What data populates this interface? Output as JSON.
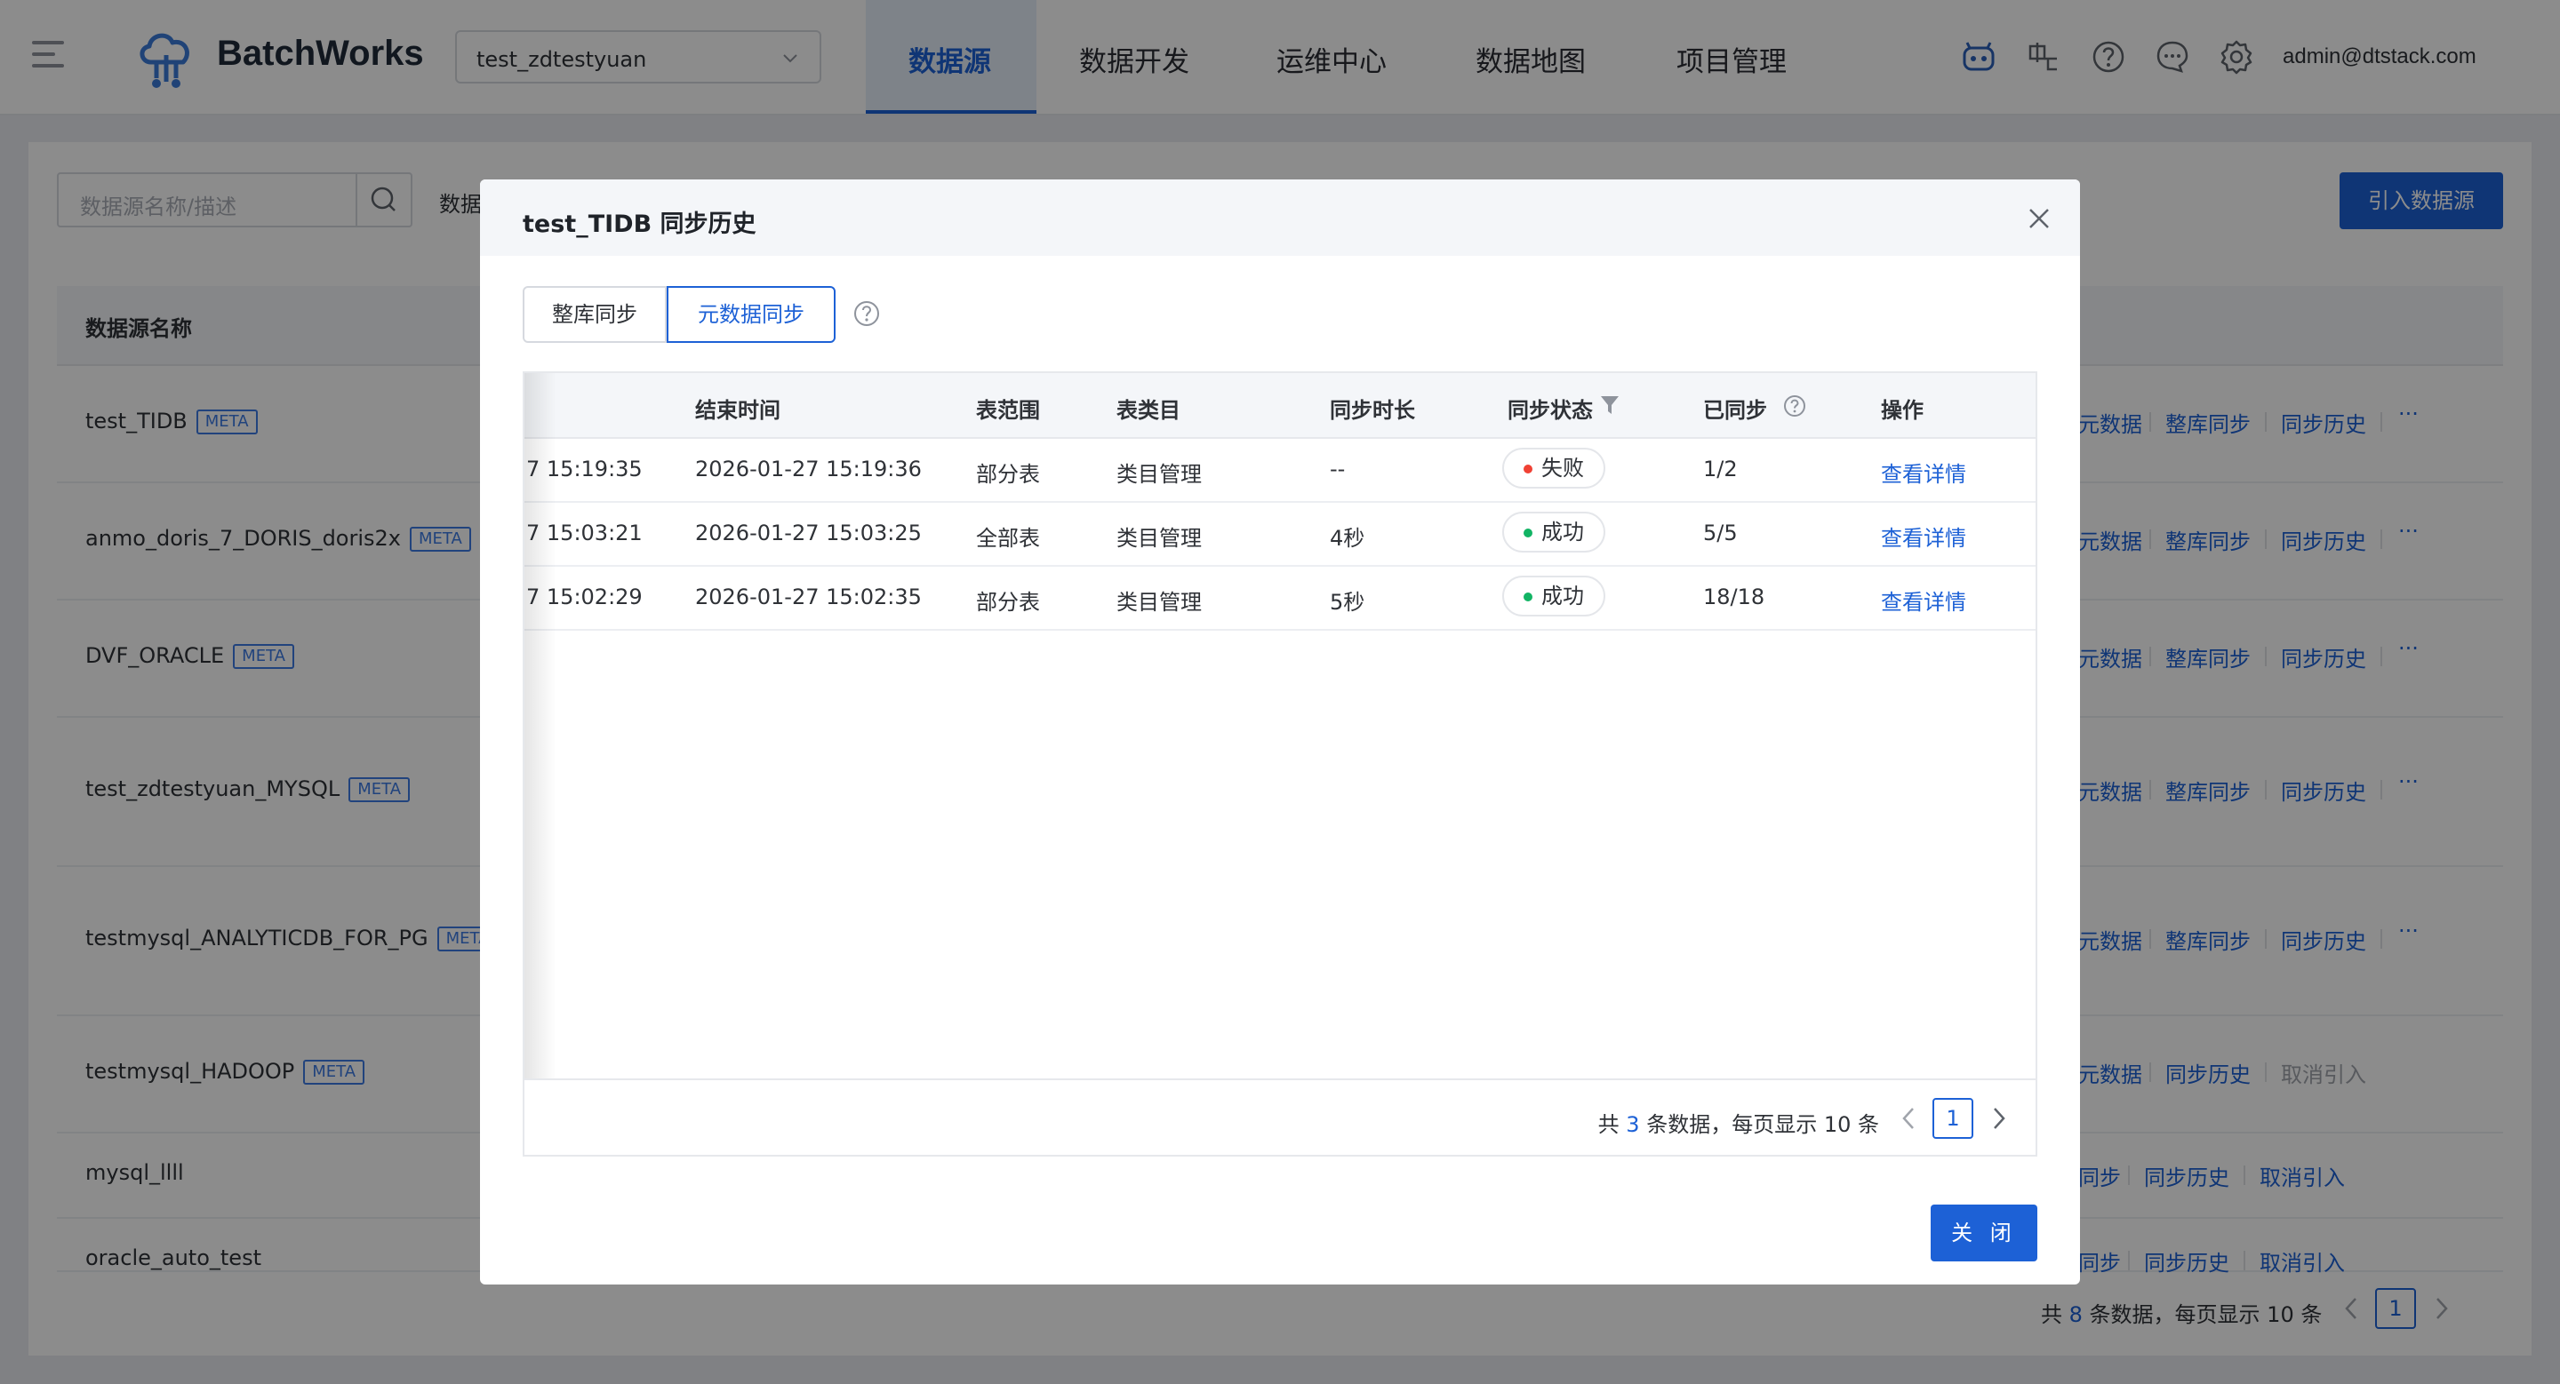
{
  "header": {
    "app_name": "BatchWorks",
    "project": "test_zdtestyuan",
    "nav": [
      "数据源",
      "数据开发",
      "运维中心",
      "数据地图",
      "项目管理"
    ],
    "active_nav": "数据源",
    "icons": [
      "robot-icon",
      "language-icon",
      "help-icon",
      "message-icon",
      "settings-icon"
    ],
    "user_email": "admin@dtstack.com"
  },
  "toolbar": {
    "search_placeholder": "数据源名称/描述",
    "filter_label": "数据",
    "import_label": "引入数据源"
  },
  "background_table": {
    "column_name": "数据源名称",
    "meta_tag": "META",
    "rows": [
      {
        "name": "test_TIDB",
        "ops": [
          "元数据",
          "整库同步",
          "同步历史",
          "···"
        ]
      },
      {
        "name": "anmo_doris_7_DORIS_doris2x",
        "ops": [
          "元数据",
          "整库同步",
          "同步历史",
          "···"
        ]
      },
      {
        "name": "DVF_ORACLE",
        "ops": [
          "元数据",
          "整库同步",
          "同步历史",
          "···"
        ]
      },
      {
        "name": "test_zdtestyuan_MYSQL",
        "ops": [
          "元数据",
          "整库同步",
          "同步历史",
          "···"
        ]
      },
      {
        "name": "testmysql_ANALYTICDB_FOR_PG",
        "ops": [
          "元数据",
          "整库同步",
          "同步历史",
          "···"
        ]
      },
      {
        "name": "testmysql_HADOOP",
        "ops": [
          "元数据",
          "同步历史",
          "取消引入"
        ]
      },
      {
        "name": "mysql_llll",
        "ops": [
          "同步",
          "同步历史",
          "取消引入"
        ]
      },
      {
        "name": "oracle_auto_test",
        "ops": [
          "同步",
          "同步历史",
          "取消引入"
        ]
      }
    ],
    "pager": {
      "prefix": "共 ",
      "total": "8",
      "suffix": " 条数据，每页显示 10 条",
      "page": "1"
    }
  },
  "modal": {
    "title": "test_TIDB 同步历史",
    "tabs": [
      "整库同步",
      "元数据同步"
    ],
    "active_tab": "元数据同步",
    "columns": [
      "结束时间",
      "表范围",
      "表类目",
      "同步时长",
      "同步状态",
      "已同步",
      "操作"
    ],
    "rows": [
      {
        "start": "7 15:19:35",
        "end": "2026-01-27 15:19:36",
        "scope": "部分表",
        "category": "类目管理",
        "duration": "--",
        "status": "失败",
        "status_color": "#f04134",
        "synced": "1/2",
        "action": "查看详情"
      },
      {
        "start": "7 15:03:21",
        "end": "2026-01-27 15:03:25",
        "scope": "全部表",
        "category": "类目管理",
        "duration": "4秒",
        "status": "成功",
        "status_color": "#12b464",
        "synced": "5/5",
        "action": "查看详情"
      },
      {
        "start": "7 15:02:29",
        "end": "2026-01-27 15:02:35",
        "scope": "部分表",
        "category": "类目管理",
        "duration": "5秒",
        "status": "成功",
        "status_color": "#12b464",
        "synced": "18/18",
        "action": "查看详情"
      }
    ],
    "pager": {
      "prefix": "共 ",
      "total": "3",
      "suffix": " 条数据，每页显示 10 条",
      "page": "1"
    },
    "close_label": "关 闭"
  }
}
